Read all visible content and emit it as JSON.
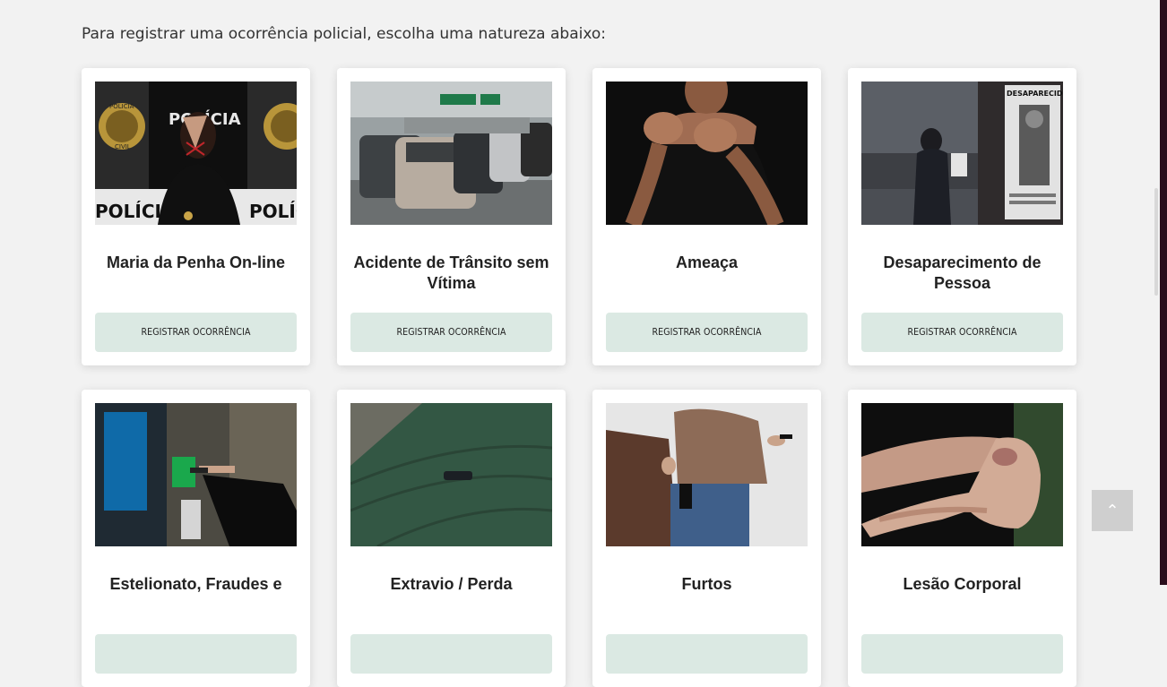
{
  "page": {
    "intro": "Para registrar uma ocorrência policial, escolha uma natureza abaixo:"
  },
  "cards": [
    {
      "title": "Maria da Penha On-line",
      "button": "REGISTRAR OCORRÊNCIA"
    },
    {
      "title": "Acidente de Trânsito sem Vítima",
      "button": "REGISTRAR OCORRÊNCIA"
    },
    {
      "title": "Ameaça",
      "button": "REGISTRAR OCORRÊNCIA"
    },
    {
      "title": "Desaparecimento de Pessoa",
      "button": "REGISTRAR OCORRÊNCIA"
    },
    {
      "title": "Estelionato, Fraudes e",
      "button": ""
    },
    {
      "title": "Extravio / Perda",
      "button": ""
    },
    {
      "title": "Furtos",
      "button": ""
    },
    {
      "title": "Lesão Corporal",
      "button": ""
    }
  ],
  "photo_text": {
    "policia_wall": "POLÍCIA",
    "badge_top": "POLICIA",
    "badge_bottom": "CIVIL",
    "poster_title": "DESAPARECIDO"
  },
  "ui": {
    "back_to_top_icon": "chevron-up-icon",
    "back_to_top_glyph": "⌃",
    "accent_button_bg": "#dbe9e3",
    "sidebar_color": "#2a0d1c"
  }
}
